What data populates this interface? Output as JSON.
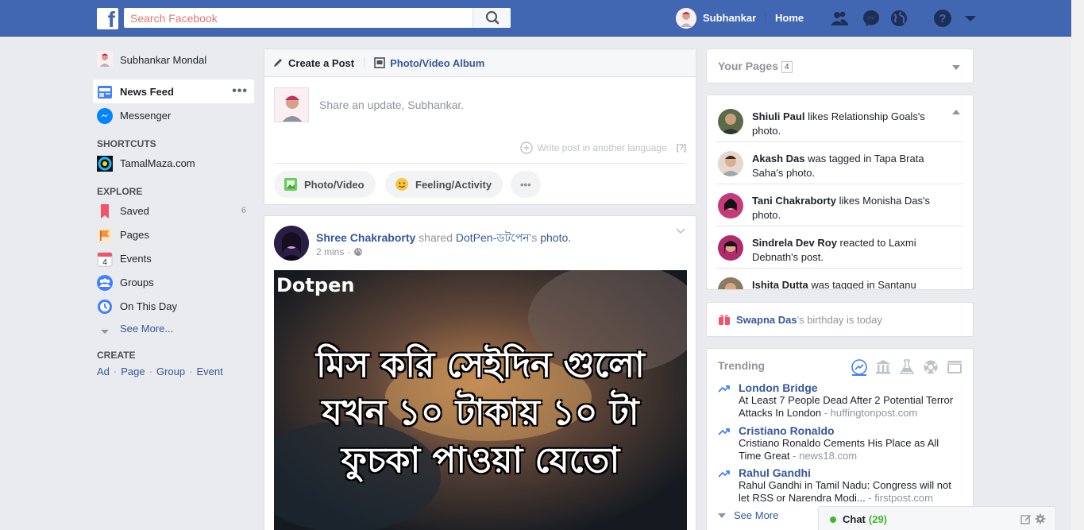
{
  "topbar": {
    "logo": "f",
    "search_placeholder": "Search Facebook",
    "user_name": "Subhankar",
    "home_label": "Home"
  },
  "left_nav": {
    "profile_name": "Subhankar Mondal",
    "items": [
      {
        "label": "News Feed"
      },
      {
        "label": "Messenger"
      }
    ],
    "shortcuts_heading": "SHORTCUTS",
    "shortcuts": [
      {
        "label": "TamalMaza.com"
      }
    ],
    "explore_heading": "EXPLORE",
    "explore": [
      {
        "label": "Saved",
        "count": "6"
      },
      {
        "label": "Pages"
      },
      {
        "label": "Events",
        "icon_text": "4"
      },
      {
        "label": "Groups"
      },
      {
        "label": "On This Day"
      },
      {
        "label": "See More..."
      }
    ],
    "create_heading": "CREATE",
    "create_links": [
      "Ad",
      "Page",
      "Group",
      "Event"
    ],
    "more_dots": "•••"
  },
  "composer": {
    "tab_create": "Create a Post",
    "tab_album": "Photo/Video Album",
    "placeholder": "Share an update, Subhankar.",
    "write_lang": "Write post in another language",
    "help": "[?]",
    "btn_photo": "Photo/Video",
    "btn_feeling": "Feeling/Activity",
    "btn_more": "•••"
  },
  "post": {
    "author": "Shree Chakraborty",
    "action": " shared ",
    "page": "DotPen-ডটপেন",
    "suffix": "'s ",
    "object": "photo.",
    "time": "2 mins",
    "time_sep": "·",
    "image": {
      "brand": "Dotpen",
      "line1": "মিস করি সেইদিন গুলো",
      "line2": "যখন ১০ টাকায় ১০ টা",
      "line3": "ফুচকা পাওয়া যেতো"
    }
  },
  "your_pages": {
    "title": "Your Pages",
    "count": "4"
  },
  "ticker": [
    {
      "name": "Shiuli Paul",
      "text": " likes Relationship Goals's photo."
    },
    {
      "name": "Akash Das",
      "text": " was tagged in Tapa Brata Saha's photo."
    },
    {
      "name": "Tani Chakraborty",
      "text": " likes Monisha Das's photo."
    },
    {
      "name": "Sindrela Dev Roy",
      "text": " reacted to Laxmi Debnath's post."
    },
    {
      "name": "Ishita Dutta",
      "text": " was tagged in Santanu"
    }
  ],
  "birthday": {
    "name": "Swapna Das",
    "text": "'s birthday is today"
  },
  "trending": {
    "title": "Trending",
    "items": [
      {
        "topic": "London Bridge",
        "desc": "At Least 7 People Dead After 2 Potential Terror Attacks In London",
        "source": " - huffingtonpost.com"
      },
      {
        "topic": "Cristiano Ronaldo",
        "desc": "Cristiano Ronaldo Cements His Place as All Time Great",
        "source": " - news18.com"
      },
      {
        "topic": "Rahul Gandhi",
        "desc": "Rahul Gandhi in Tamil Nadu: Congress will not let RSS or Narendra Modi...",
        "source": " - firstpost.com"
      }
    ],
    "see_more": "See More"
  },
  "chat": {
    "label": "Chat",
    "count": "(29)"
  },
  "colors": {
    "brand": "#4267b2",
    "link": "#365899",
    "online": "#42b72a"
  }
}
